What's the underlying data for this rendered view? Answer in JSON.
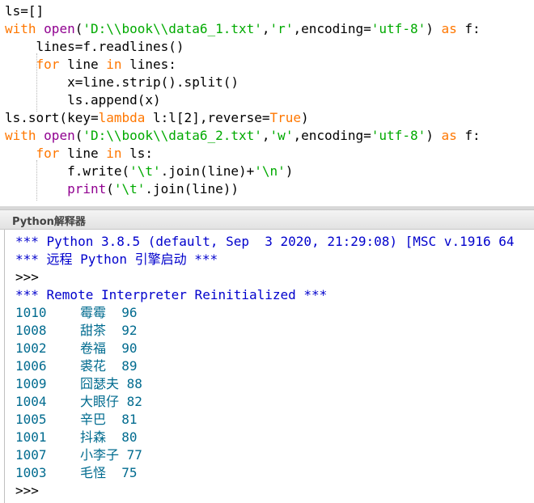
{
  "editor": {
    "lines": [
      [
        {
          "t": "ls=[]",
          "c": ""
        }
      ],
      [
        {
          "t": "with",
          "c": "kw"
        },
        {
          "t": " ",
          "c": ""
        },
        {
          "t": "open",
          "c": "bi"
        },
        {
          "t": "(",
          "c": ""
        },
        {
          "t": "'D:\\\\book\\\\data6_1.txt'",
          "c": "str"
        },
        {
          "t": ",",
          "c": ""
        },
        {
          "t": "'r'",
          "c": "str"
        },
        {
          "t": ",encoding=",
          "c": ""
        },
        {
          "t": "'utf-8'",
          "c": "str"
        },
        {
          "t": ") ",
          "c": ""
        },
        {
          "t": "as",
          "c": "kw"
        },
        {
          "t": " f:",
          "c": ""
        }
      ],
      [
        {
          "t": "    lines=f.readlines()",
          "c": ""
        }
      ],
      [
        {
          "t": "    ",
          "c": ""
        },
        {
          "t": "for",
          "c": "kw"
        },
        {
          "t": " line ",
          "c": ""
        },
        {
          "t": "in",
          "c": "kw"
        },
        {
          "t": " lines:",
          "c": ""
        }
      ],
      [
        {
          "t": "        x=line.strip().split()",
          "c": ""
        }
      ],
      [
        {
          "t": "        ls.append(x)",
          "c": ""
        }
      ],
      [
        {
          "t": "ls.sort(key=",
          "c": ""
        },
        {
          "t": "lambda",
          "c": "kw"
        },
        {
          "t": " l:l[2],reverse=",
          "c": ""
        },
        {
          "t": "True",
          "c": "kw"
        },
        {
          "t": ")",
          "c": ""
        }
      ],
      [
        {
          "t": "with",
          "c": "kw"
        },
        {
          "t": " ",
          "c": ""
        },
        {
          "t": "open",
          "c": "bi"
        },
        {
          "t": "(",
          "c": ""
        },
        {
          "t": "'D:\\\\book\\\\data6_2.txt'",
          "c": "str"
        },
        {
          "t": ",",
          "c": ""
        },
        {
          "t": "'w'",
          "c": "str"
        },
        {
          "t": ",encoding=",
          "c": ""
        },
        {
          "t": "'utf-8'",
          "c": "str"
        },
        {
          "t": ") ",
          "c": ""
        },
        {
          "t": "as",
          "c": "kw"
        },
        {
          "t": " f:",
          "c": ""
        }
      ],
      [
        {
          "t": "    ",
          "c": ""
        },
        {
          "t": "for",
          "c": "kw"
        },
        {
          "t": " line ",
          "c": ""
        },
        {
          "t": "in",
          "c": "kw"
        },
        {
          "t": " ls:",
          "c": ""
        }
      ],
      [
        {
          "t": "        f.write(",
          "c": ""
        },
        {
          "t": "'\\t'",
          "c": "str"
        },
        {
          "t": ".join(line)+",
          "c": ""
        },
        {
          "t": "'\\n'",
          "c": "str"
        },
        {
          "t": ")",
          "c": ""
        }
      ],
      [
        {
          "t": "        ",
          "c": ""
        },
        {
          "t": "print",
          "c": "bi"
        },
        {
          "t": "(",
          "c": ""
        },
        {
          "t": "'\\t'",
          "c": "str"
        },
        {
          "t": ".join(line))",
          "c": ""
        }
      ]
    ]
  },
  "panel": {
    "title": "Python解释器"
  },
  "console": {
    "banner": "*** Python 3.8.5 (default, Sep  3 2020, 21:29:08) [MSC v.1916 64",
    "remote_cn": "*** 远程 Python 引擎启动 ***",
    "prompt": ">>>",
    "reinit": "*** Remote Interpreter Reinitialized ***",
    "rows": [
      {
        "id": "1010",
        "name": "霉霉",
        "score": "96"
      },
      {
        "id": "1008",
        "name": "甜茶",
        "score": "92"
      },
      {
        "id": "1002",
        "name": "卷福",
        "score": "90"
      },
      {
        "id": "1006",
        "name": "裘花",
        "score": "89"
      },
      {
        "id": "1009",
        "name": "囧瑟夫",
        "score": "88"
      },
      {
        "id": "1004",
        "name": "大眼仔",
        "score": "82"
      },
      {
        "id": "1005",
        "name": "辛巴",
        "score": "81"
      },
      {
        "id": "1001",
        "name": "抖森",
        "score": "80"
      },
      {
        "id": "1007",
        "name": "小李子",
        "score": "77"
      },
      {
        "id": "1003",
        "name": "毛怪",
        "score": "75"
      }
    ],
    "final_prompt": ">>>"
  }
}
